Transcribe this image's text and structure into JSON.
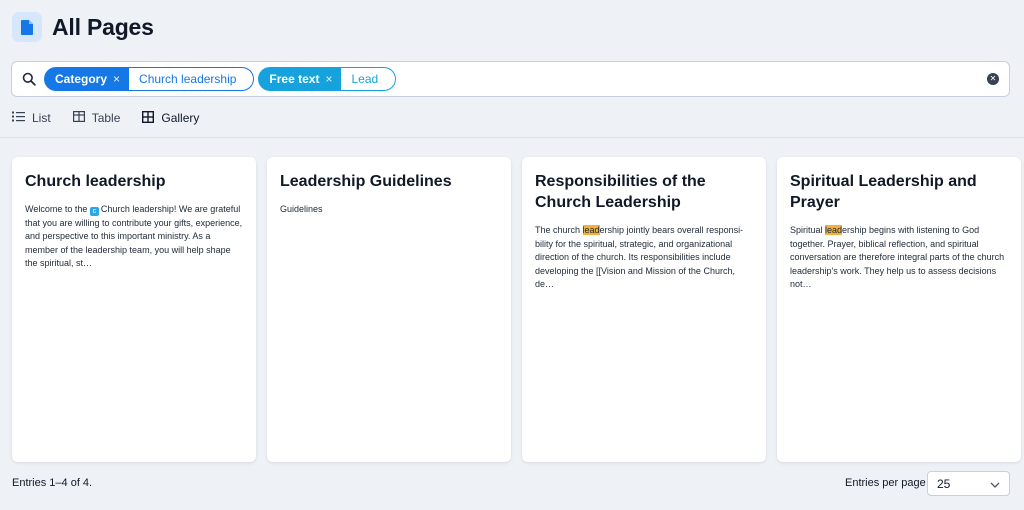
{
  "header": {
    "title": "All Pages",
    "icon": "document-icon"
  },
  "search": {
    "filters": [
      {
        "key": "Category",
        "value": "Church leadership",
        "color": "#1677e6"
      },
      {
        "key": "Free text",
        "value": "Lead",
        "color": "#16a3dd"
      }
    ],
    "remove_symbol": "×"
  },
  "views": [
    {
      "label": "List",
      "icon": "list-icon"
    },
    {
      "label": "Table",
      "icon": "table-icon"
    },
    {
      "label": "Gallery",
      "icon": "gallery-icon",
      "active": true
    }
  ],
  "cards": [
    {
      "title": "Church leadership",
      "text_before": "Welcome to the",
      "link_badge": "c",
      "text_after": "Church leadership! We are grateful that you are willing to contribute your gifts, experience, and perspective to this important ministry. As a member of the leadership team, you will help shape the spiritual, st…"
    },
    {
      "title": "Leadership Guidelines",
      "text": "Guidelines"
    },
    {
      "title": "Responsibilities of the Church Leadership",
      "text_before": "The church ",
      "highlight": "lead",
      "text_after": "ership jointly bears overall responsi-bility for the spiritual, strategic, and organizational direction of the church. Its responsibilities include developing the [[Vision and Mission of the Church, de…"
    },
    {
      "title": "Spiritual Leadership and Prayer",
      "text_before": "Spiritual ",
      "highlight": "lead",
      "text_after": "ership begins with listening to God together. Prayer, biblical reflection, and spiritual conversation are therefore integral parts of the church leadership's work. They help us to assess decisions not…"
    }
  ],
  "footer": {
    "entries_text": "Entries 1–4 of 4.",
    "per_page_label": "Entries per page",
    "per_page_value": "25"
  },
  "colors": {
    "highlight": "#f3b13a",
    "accent": "#1677e6",
    "background": "#eef2f7"
  }
}
